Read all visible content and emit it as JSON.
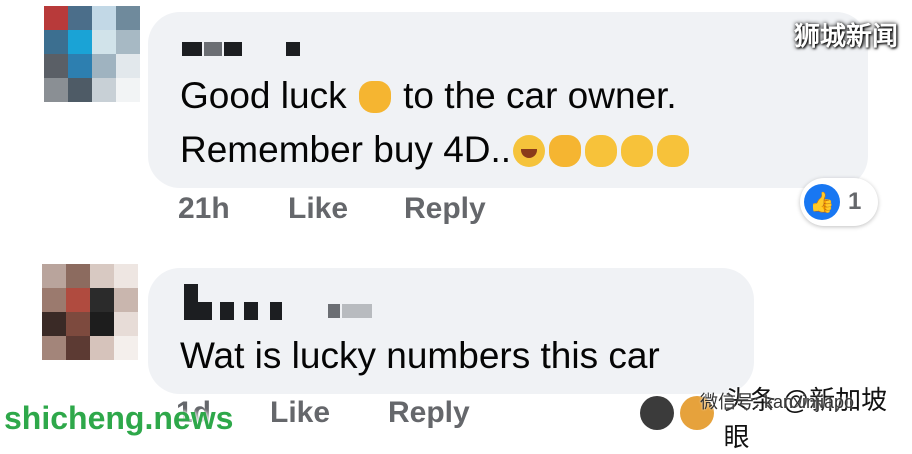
{
  "watermarks": {
    "top_right": "狮城新闻",
    "bottom_left": "shicheng.news",
    "bottom_right_id": "微信号: kanxinjiapo",
    "bottom_right_text": "头条 @新加坡眼"
  },
  "comments": [
    {
      "line1": "Good luck",
      "line1_after": "to the car owner.",
      "line2": "Remember buy 4D..",
      "time": "21h",
      "like_label": "Like",
      "reply_label": "Reply",
      "reaction_count": "1",
      "avatar_colors": [
        "#b83a3a",
        "#4b6e8a",
        "#c2d8e6",
        "#6f8a9c",
        "#3c6f90",
        "#1aa3d6",
        "#d1e3ea",
        "#a7b9c4",
        "#5a5f66",
        "#2d7fb0",
        "#9fb3c0",
        "#e2e8ec",
        "#8a8f94",
        "#4e5b66",
        "#c8d0d6",
        "#f2f4f5"
      ]
    },
    {
      "line1": "Wat is lucky numbers  this car",
      "time": "1d",
      "like_label": "Like",
      "reply_label": "Reply",
      "avatar_colors": [
        "#b9a49c",
        "#8c6b5f",
        "#d8c9c2",
        "#eee6e2",
        "#9b7a6e",
        "#b04b3f",
        "#2b2b2b",
        "#c9b6ae",
        "#3a2a26",
        "#7d4a3e",
        "#1d1d1d",
        "#e7dcd7",
        "#a3857a",
        "#5c3a33",
        "#d6c3bb",
        "#f4efec"
      ]
    }
  ],
  "colors": {
    "bubble_bg": "#f0f2f5",
    "action_text": "#65676b",
    "like_blue": "#1877f2"
  }
}
